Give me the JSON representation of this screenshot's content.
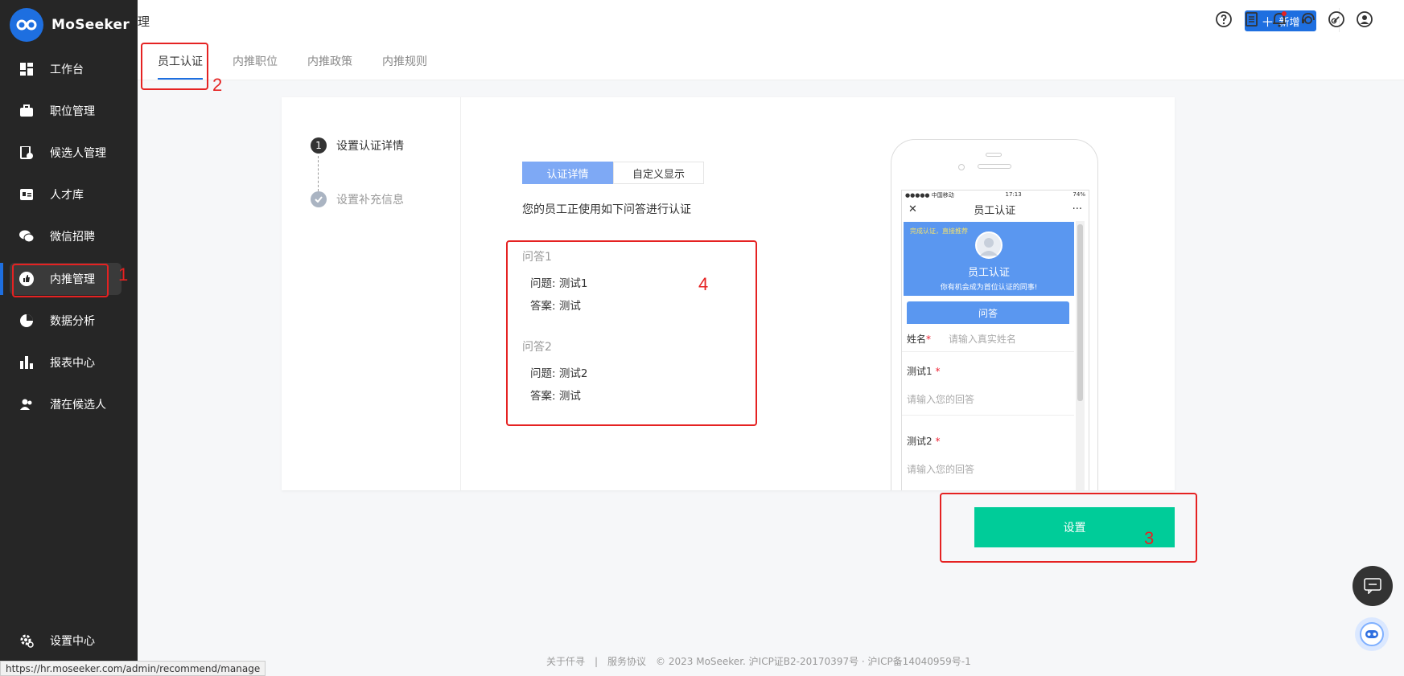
{
  "brand": {
    "name": "MoSeeker",
    "logo_sub": "MoSeeker"
  },
  "header": {
    "new_button": "新增",
    "fragment_char": "理"
  },
  "sidebar": {
    "items": [
      {
        "label": "工作台",
        "icon": "dashboard-icon"
      },
      {
        "label": "职位管理",
        "icon": "briefcase-icon"
      },
      {
        "label": "候选人管理",
        "icon": "candidate-doc-icon"
      },
      {
        "label": "人才库",
        "icon": "id-card-icon"
      },
      {
        "label": "微信招聘",
        "icon": "wechat-icon"
      },
      {
        "label": "内推管理",
        "icon": "thumb-up-icon",
        "active": true
      },
      {
        "label": "数据分析",
        "icon": "pie-chart-icon"
      },
      {
        "label": "报表中心",
        "icon": "bar-chart-icon"
      },
      {
        "label": "潜在候选人",
        "icon": "users-icon"
      }
    ],
    "settings": "设置中心"
  },
  "tabs": [
    {
      "label": "员工认证",
      "active": true
    },
    {
      "label": "内推职位"
    },
    {
      "label": "内推政策"
    },
    {
      "label": "内推规则"
    }
  ],
  "steps": {
    "step1_num": "1",
    "step1": "设置认证详情",
    "step2": "设置补充信息"
  },
  "segment": {
    "on": "认证详情",
    "off": "自定义显示"
  },
  "description": "您的员工正使用如下问答进行认证",
  "qa": [
    {
      "title": "问答1",
      "question": "问题: 测试1",
      "answer": "答案: 测试"
    },
    {
      "title": "问答2",
      "question": "问题: 测试2",
      "answer": "答案: 测试"
    }
  ],
  "phone": {
    "status_left": "●●●●● 中国移动 ",
    "status_time": "17:13",
    "status_right": "74%",
    "nav_close": "✕",
    "nav_title": "员工认证",
    "nav_more": "···",
    "tagline": "完成认证，直接推荐",
    "banner_title": "员工认证",
    "banner_sub": "你有机会成为首位认证的同事!",
    "qa_tab": "问答",
    "name_label": "姓名",
    "required_mark": "*",
    "name_placeholder": "请输入真实姓名",
    "q1_label": "测试1",
    "q1_placeholder": "请输入您的回答",
    "q2_label": "测试2",
    "q2_placeholder": "请输入您的回答"
  },
  "set_button": "设置",
  "annotations": [
    "1",
    "2",
    "3",
    "4"
  ],
  "footer": "关于仟寻　|　服务协议　© 2023 MoSeeker. 沪ICP证B2-20170397号 · 沪ICP备14040959号-1",
  "status_url": "https://hr.moseeker.com/admin/recommend/manage",
  "colors": {
    "primary": "#1e6fe0",
    "success": "#00cc99",
    "annotation": "#e52222",
    "sidebar": "#262626"
  }
}
